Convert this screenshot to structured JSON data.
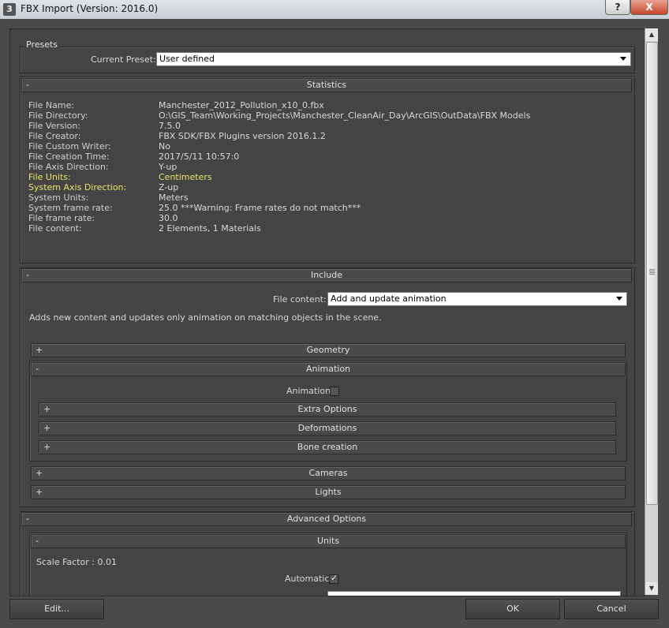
{
  "window": {
    "title": "FBX Import (Version: 2016.0)",
    "help_label": "?",
    "close_label": "X"
  },
  "presets": {
    "group_label": "Presets",
    "current_preset_label": "Current Preset:",
    "current_preset_value": "User defined"
  },
  "statistics": {
    "title": "Statistics",
    "rows": [
      {
        "label": "File Name:",
        "value": "Manchester_2012_Pollution_x10_0.fbx"
      },
      {
        "label": "File Directory:",
        "value": "O:\\GIS_Team\\Working_Projects\\Manchester_CleanAir_Day\\ArcGIS\\OutData\\FBX Models"
      },
      {
        "label": "File Version:",
        "value": "7.5.0"
      },
      {
        "label": "File Creator:",
        "value": "FBX SDK/FBX Plugins version 2016.1.2"
      },
      {
        "label": "File Custom Writer:",
        "value": "No"
      },
      {
        "label": "File Creation Time:",
        "value": "2017/5/11  10:57:0"
      },
      {
        "label": "File Axis Direction:",
        "value": "Y-up"
      },
      {
        "label": "File Units:",
        "value": "Centimeters"
      },
      {
        "label": "System Axis Direction:",
        "value": "Z-up"
      },
      {
        "label": "System Units:",
        "value": "Meters"
      },
      {
        "label": "System frame rate:",
        "value": "25.0  ***Warning: Frame rates do not match***"
      },
      {
        "label": "File frame rate:",
        "value": "30.0"
      },
      {
        "label": "File content:",
        "value": "2 Elements,    1 Materials"
      }
    ]
  },
  "include": {
    "title": "Include",
    "file_content_label": "File content:",
    "file_content_value": "Add and update animation",
    "description": "Adds new content and updates only animation on matching objects in the scene.",
    "geometry": "Geometry",
    "animation": {
      "title": "Animation",
      "checkbox_label": "Animation",
      "extra_options": "Extra Options",
      "deformations": "Deformations",
      "bone_creation": "Bone creation"
    },
    "cameras": "Cameras",
    "lights": "Lights"
  },
  "advanced": {
    "title": "Advanced Options",
    "units": {
      "title": "Units",
      "scale_factor": "Scale Factor : 0.01",
      "automatic_label": "Automatic"
    }
  },
  "signs": {
    "expanded": "-",
    "collapsed": "+",
    "check": "✓"
  },
  "footer": {
    "edit": "Edit...",
    "ok": "OK",
    "cancel": "Cancel"
  }
}
